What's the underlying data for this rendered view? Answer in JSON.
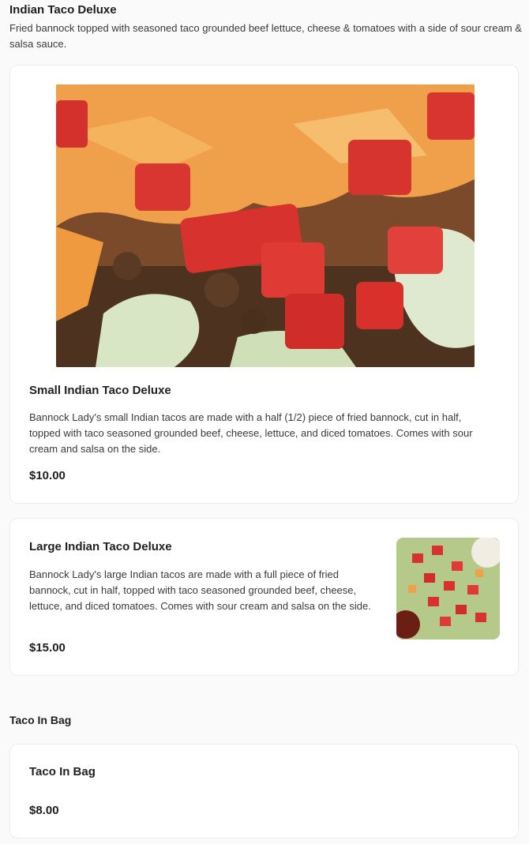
{
  "sections": [
    {
      "title": "Indian Taco Deluxe",
      "description": "Fried bannock topped with seasoned taco grounded beef lettuce, cheese & tomatoes with a side of sour cream & salsa sauce.",
      "items": [
        {
          "name": "Small Indian Taco Deluxe",
          "description": "Bannock Lady's small Indian tacos are made with a half (1/2) piece of fried bannock, cut in half, topped with taco seasoned grounded beef, cheese, lettuce, and diced tomatoes. Comes with sour cream and salsa on the side.",
          "price": "$10.00",
          "image": "taco-photo"
        },
        {
          "name": "Large Indian Taco Deluxe",
          "description": "Bannock Lady's large Indian tacos are made with a full piece of fried bannock, cut in half, topped with taco seasoned grounded beef, cheese, lettuce, and diced tomatoes. Comes with sour cream and salsa on the side.",
          "price": "$15.00",
          "image": "taco-thumbnail"
        }
      ]
    },
    {
      "title": "Taco In Bag",
      "items": [
        {
          "name": "Taco In Bag",
          "price": "$8.00"
        }
      ]
    }
  ],
  "colors": {
    "background": "#fafafa",
    "card": "#ffffff",
    "text": "#1f1f1f",
    "muted": "#3a3a3a"
  }
}
